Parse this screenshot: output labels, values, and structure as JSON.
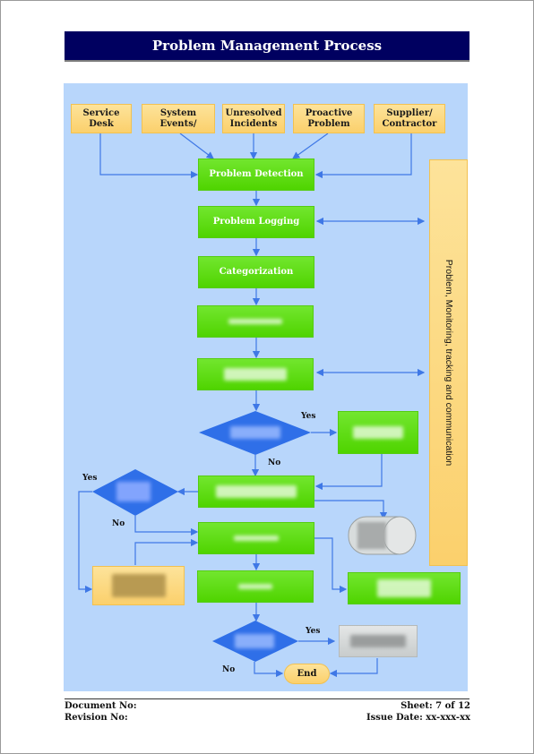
{
  "header": {
    "title": "Problem Management Process"
  },
  "sources": [
    {
      "id": "service-desk",
      "label": "Service Desk"
    },
    {
      "id": "system-events",
      "label": "System Events/"
    },
    {
      "id": "unresolved-incidents",
      "label": "Unresolved Incidents"
    },
    {
      "id": "proactive-problem",
      "label": "Proactive Problem"
    },
    {
      "id": "supplier-contractor",
      "label": "Supplier/ Contractor"
    }
  ],
  "process": {
    "detection": "Problem Detection",
    "logging": "Problem Logging",
    "categorization": "Categorization",
    "prioritization": "",
    "investigation": "",
    "workaround_decision": "",
    "provide_workaround": "",
    "known_error_record": "",
    "known_error_decision": "",
    "resolution": "",
    "change_box": "",
    "closure": "",
    "right_box": "",
    "database": "",
    "major_problem_decision": "",
    "major_problem_review": "",
    "end": "End"
  },
  "side_panel": {
    "label": "Problem, Monitoring, tracking and communication"
  },
  "edge_labels": {
    "workaround_yes": "Yes",
    "workaround_no": "No",
    "known_error_yes": "Yes",
    "known_error_no": "No",
    "major_yes": "Yes",
    "major_no": "No"
  },
  "footer": {
    "document_no": "Document No:",
    "revision_no": "Revision No:",
    "sheet": "Sheet: 7 of 12",
    "issue_date": "Issue Date: xx-xxx-xx"
  },
  "colors": {
    "title_bg": "#000060",
    "canvas_bg": "#b8d6fb",
    "process_green": "#5ada0c",
    "source_yellow": "#fdd67a",
    "decision_blue": "#2f6fe8",
    "arrow_blue": "#3f78e6"
  }
}
